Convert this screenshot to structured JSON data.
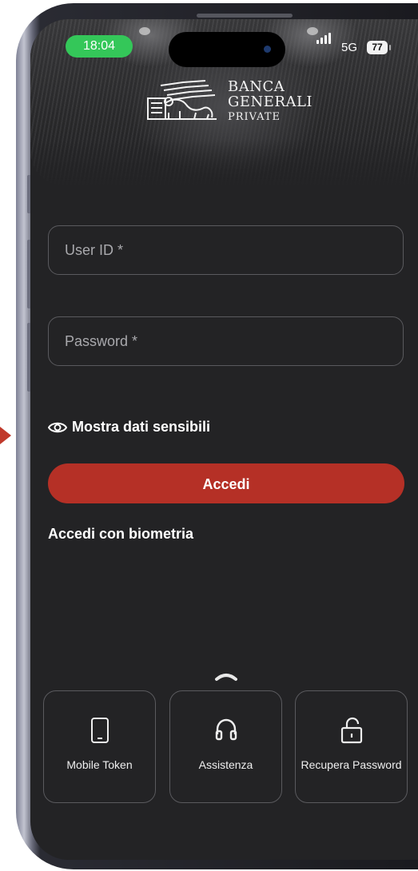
{
  "status_bar": {
    "time": "18:04",
    "network": "5G",
    "battery": "77"
  },
  "brand": {
    "line1": "BANCA",
    "line2": "GENERALI",
    "line3": "PRIVATE"
  },
  "login_form": {
    "user_id_placeholder": "User ID *",
    "password_placeholder": "Password *",
    "show_sensitive_label": "Mostra dati sensibili",
    "login_button_label": "Accedi",
    "biometric_label": "Accedi con biometria"
  },
  "quick_actions": [
    {
      "label": "Mobile Token",
      "icon": "smartphone-icon"
    },
    {
      "label": "Assistenza",
      "icon": "headset-icon"
    },
    {
      "label": "Recupera Password",
      "icon": "unlock-icon"
    }
  ],
  "colors": {
    "background": "#232325",
    "accent": "#b53026",
    "status_time_pill": "#34c759"
  }
}
